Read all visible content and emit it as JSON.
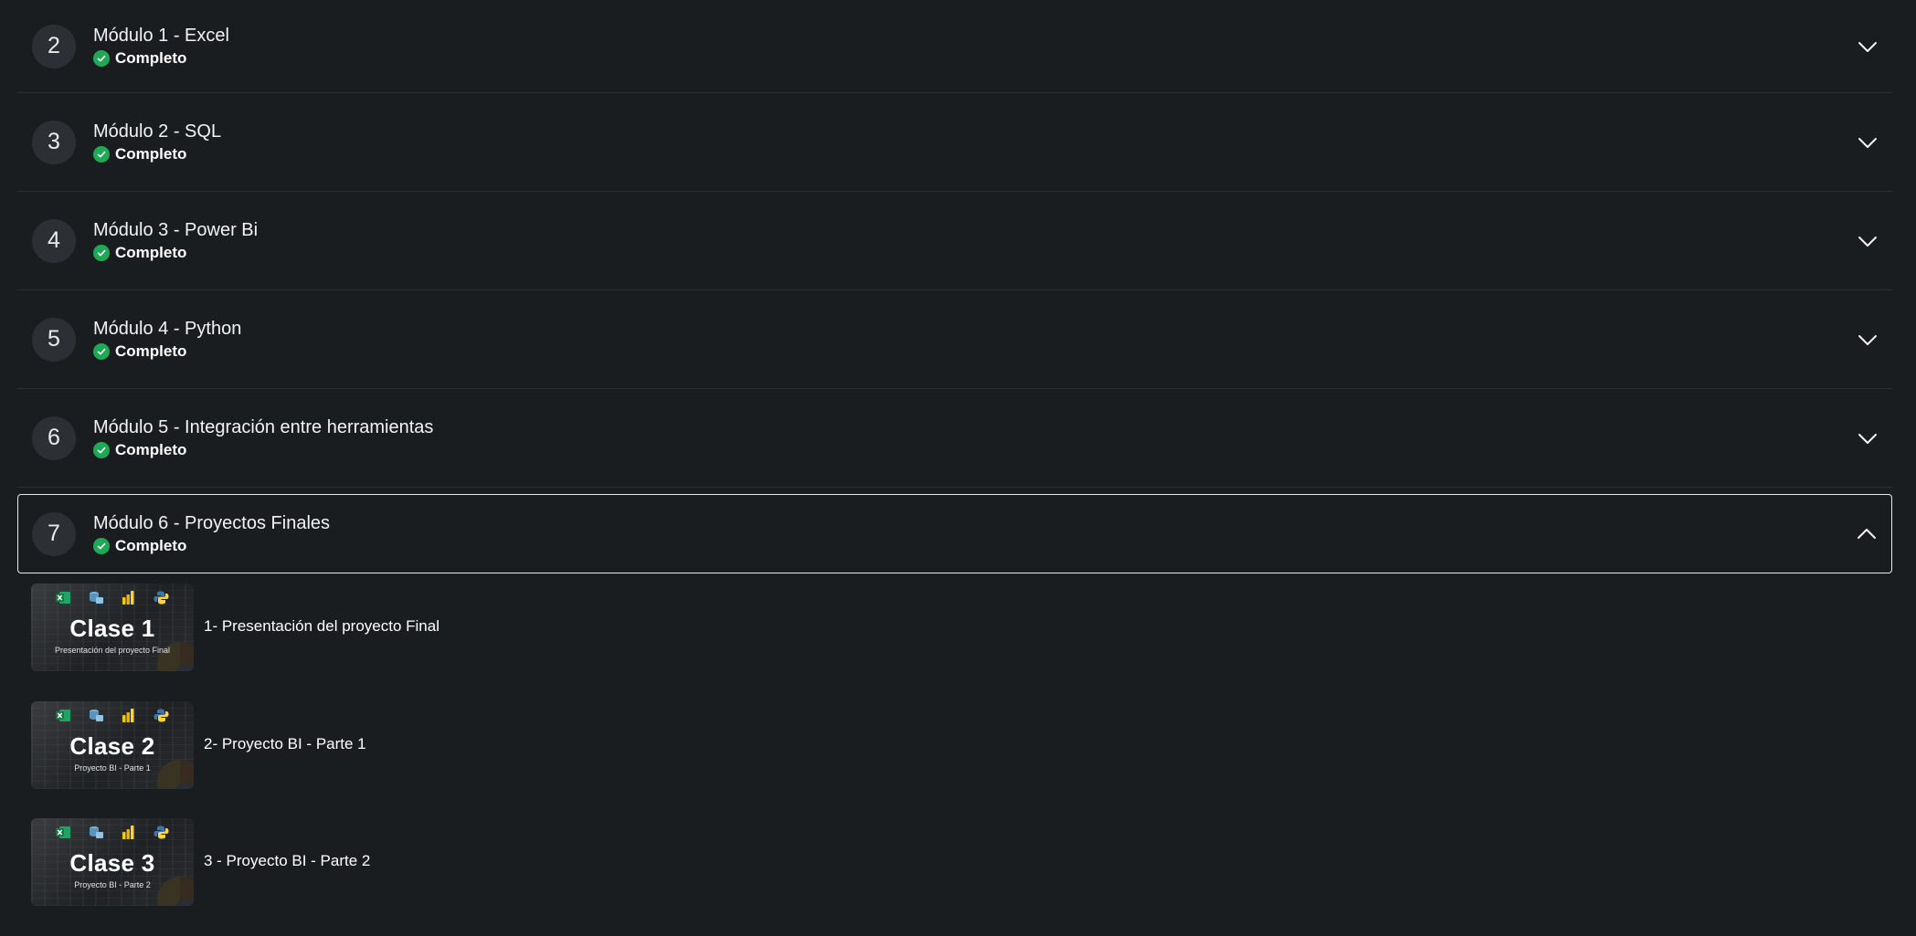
{
  "modules": [
    {
      "number": "2",
      "title": "Módulo 1 - Excel",
      "status": "Completo"
    },
    {
      "number": "3",
      "title": "Módulo 2 - SQL",
      "status": "Completo"
    },
    {
      "number": "4",
      "title": "Módulo 3 - Power Bi",
      "status": "Completo"
    },
    {
      "number": "5",
      "title": "Módulo 4 - Python",
      "status": "Completo"
    },
    {
      "number": "6",
      "title": "Módulo 5 - Integración entre herramientas",
      "status": "Completo"
    },
    {
      "number": "7",
      "title": "Módulo 6 - Proyectos Finales",
      "status": "Completo",
      "expanded": true
    }
  ],
  "lessons": [
    {
      "thumb_title": "Clase 1",
      "thumb_subtitle": "Presentación del proyecto Final",
      "title": "1- Presentación del proyecto Final"
    },
    {
      "thumb_title": "Clase 2",
      "thumb_subtitle": "Proyecto BI - Parte 1",
      "title": "2- Proyecto BI - Parte 1"
    },
    {
      "thumb_title": "Clase 3",
      "thumb_subtitle": "Proyecto BI - Parte 2",
      "title": "3 - Proyecto BI - Parte 2"
    }
  ],
  "thumbnail_icons": [
    "excel-icon",
    "sql-server-icon",
    "power-bi-icon",
    "python-icon"
  ],
  "colors": {
    "background": "#1a1d20",
    "number_circle": "#2c3034",
    "status_check": "#1fa855",
    "expanded_border": "#e9ecef",
    "divider": "#2b2f33"
  }
}
